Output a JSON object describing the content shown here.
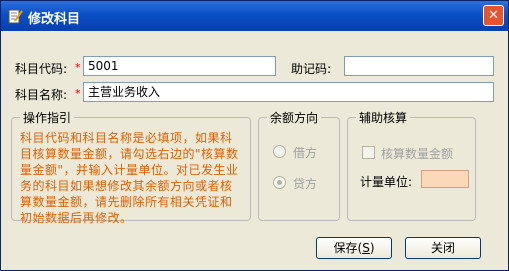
{
  "window": {
    "title": "修改科目",
    "close_glyph": "✕",
    "title_color": "#0a4fc6"
  },
  "form": {
    "code_label": "科目代码:",
    "code_value": "5001",
    "mnemonic_label": "助记码:",
    "mnemonic_value": "",
    "name_label": "科目名称:",
    "name_value": "主营业务收入",
    "required_mark": "*"
  },
  "guide": {
    "title": "操作指引",
    "text": "科目代码和科目名称是必填项，如果科目核算数量金额，请勾选右边的\"核算数量金额\"，并输入计量单位。对已发生业务的科目如果想修改其余额方向或者核算数量金额，请先删除所有相关凭证和初始数据后再修改。",
    "text_color": "#e06000"
  },
  "direction": {
    "title": "余额方向",
    "options": [
      {
        "label": "借方",
        "selected": false
      },
      {
        "label": "贷方",
        "selected": true
      }
    ]
  },
  "aux": {
    "title": "辅助核算",
    "qty_checkbox_label": "核算数量金额",
    "qty_checked": false,
    "unit_label": "计量单位:",
    "unit_value": ""
  },
  "buttons": {
    "save_label": "保存(",
    "save_key": "S",
    "save_suffix": ")",
    "close_label": "关闭"
  }
}
